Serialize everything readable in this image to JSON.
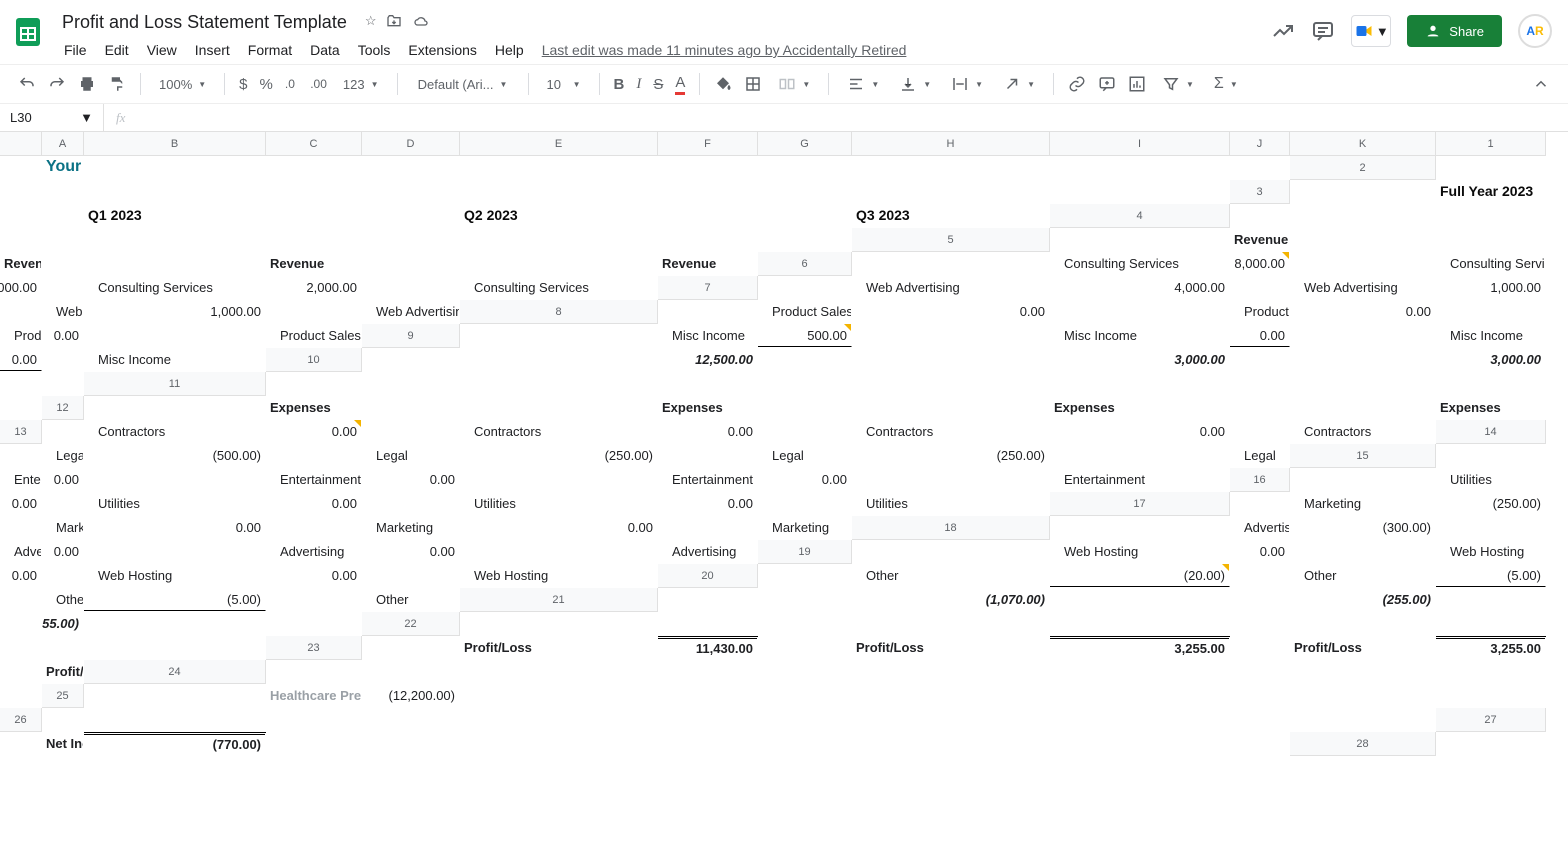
{
  "doc": {
    "title": "Profit and Loss Statement Template",
    "lastEdit": "Last edit was made 11 minutes ago by Accidentally Retired"
  },
  "menus": [
    "File",
    "Edit",
    "View",
    "Insert",
    "Format",
    "Data",
    "Tools",
    "Extensions",
    "Help"
  ],
  "share": "Share",
  "toolbar": {
    "zoom": "100%",
    "font": "Default (Ari...",
    "size": "10",
    "numfmt": "123"
  },
  "namebox": "L30",
  "cols": [
    "A",
    "B",
    "C",
    "D",
    "E",
    "F",
    "G",
    "H",
    "I",
    "J",
    "K"
  ],
  "rows": 28,
  "company": "Your Company, LLC",
  "periods": {
    "full": {
      "title": "Full Year 2023",
      "rev": [
        "8,000.00",
        "4,000.00",
        "0.00",
        "500.00"
      ],
      "revTotal": "12,500.00",
      "exp": [
        "0.00",
        "(500.00)",
        "0.00",
        "0.00",
        "(250.00)",
        "(300.00)",
        "0.00",
        "(20.00)"
      ],
      "expTotal": "(1,070.00)",
      "pl": "11,430.00",
      "hc": "(12,200.00)",
      "ni": "(770.00)"
    },
    "q1": {
      "title": "Q1 2023",
      "rev": [
        "2,000.00",
        "1,000.00",
        "0.00",
        "0.00"
      ],
      "revTotal": "3,000.00",
      "exp": [
        "0.00",
        "(250.00)",
        "0.00",
        "0.00",
        "0.00",
        "0.00",
        "0.00",
        "(5.00)"
      ],
      "expTotal": "(255.00)",
      "pl": "3,255.00"
    },
    "q2": {
      "title": "Q2 2023",
      "rev": [
        "2,000.00",
        "1,000.00",
        "0.00",
        "0.00"
      ],
      "revTotal": "3,000.00",
      "exp": [
        "0.00",
        "(250.00)",
        "0.00",
        "0.00",
        "0.00",
        "0.00",
        "0.00",
        "(5.00)"
      ],
      "expTotal": "(255.00)",
      "pl": "3,255.00"
    },
    "q3": {
      "title": "Q3 2023"
    }
  },
  "labels": {
    "revenue": "Revenue",
    "revItems": [
      "Consulting Services",
      "Web Advertising",
      "Product Sales",
      "Misc Income"
    ],
    "expenses": "Expenses",
    "expItems": [
      "Contractors",
      "Legal",
      "Entertainment",
      "Utilities",
      "Marketing",
      "Advertising",
      "Web Hosting",
      "Other"
    ],
    "pl": "Profit/Loss",
    "hc": "Healthcare Premiums",
    "ni": "Net Income"
  }
}
